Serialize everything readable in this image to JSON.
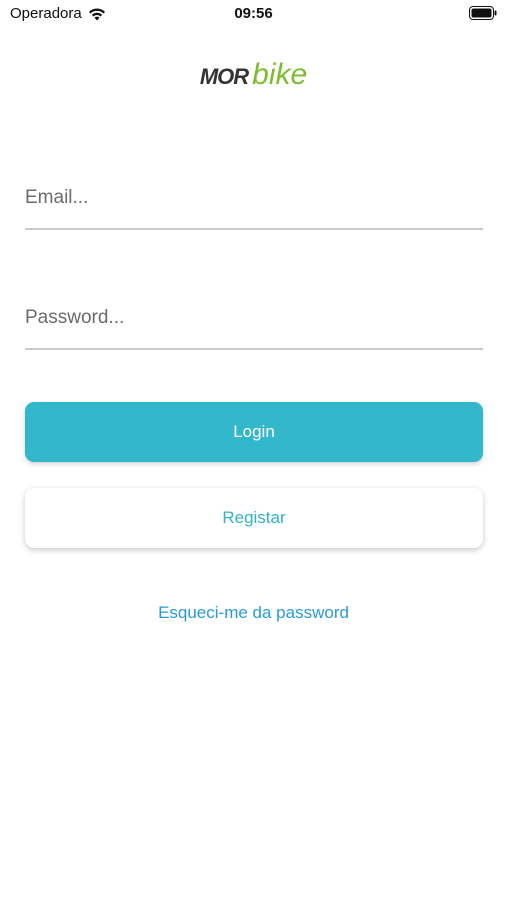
{
  "status_bar": {
    "carrier": "Operadora",
    "time": "09:56"
  },
  "logo": {
    "mor": "MOR",
    "bike": "bike"
  },
  "form": {
    "email_placeholder": "Email...",
    "password_placeholder": "Password...",
    "login_label": "Login",
    "register_label": "Registar",
    "forgot_label": "Esqueci-me da password"
  },
  "colors": {
    "accent": "#33b7cb",
    "brand_green": "#7dbb2f",
    "link": "#2a9ad8"
  }
}
